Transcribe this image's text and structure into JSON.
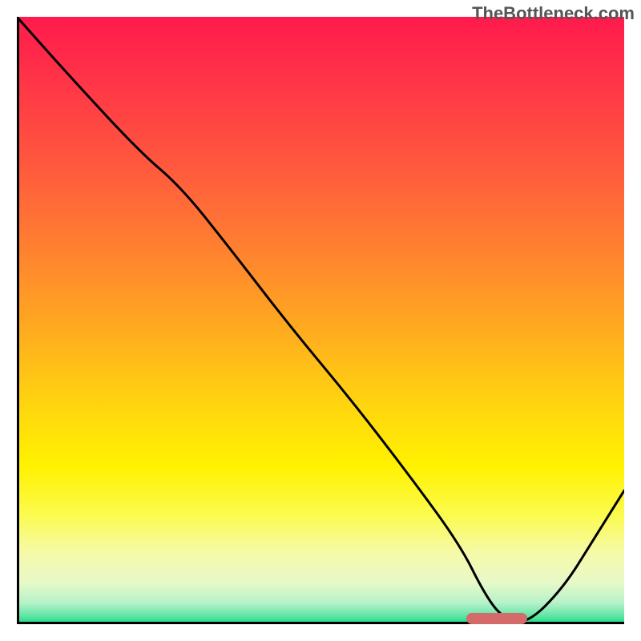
{
  "watermark": "TheBottleneck.com",
  "colors": {
    "frame": "#000000",
    "curve": "#000000",
    "marker": "#d46a6a",
    "gradient_stops": [
      {
        "offset": 0.0,
        "color": "#ff1a4d"
      },
      {
        "offset": 0.12,
        "color": "#ff3846"
      },
      {
        "offset": 0.25,
        "color": "#ff5a3d"
      },
      {
        "offset": 0.38,
        "color": "#ff8030"
      },
      {
        "offset": 0.5,
        "color": "#ffa621"
      },
      {
        "offset": 0.62,
        "color": "#ffcf12"
      },
      {
        "offset": 0.74,
        "color": "#fff200"
      },
      {
        "offset": 0.82,
        "color": "#fbfb4e"
      },
      {
        "offset": 0.88,
        "color": "#f6faa6"
      },
      {
        "offset": 0.93,
        "color": "#e8f9c8"
      },
      {
        "offset": 0.965,
        "color": "#b6f2c9"
      },
      {
        "offset": 0.985,
        "color": "#66e6a8"
      },
      {
        "offset": 1.0,
        "color": "#12db82"
      }
    ]
  },
  "chart_data": {
    "type": "line",
    "title": "",
    "xlabel": "",
    "ylabel": "",
    "xlim": [
      0,
      100
    ],
    "ylim": [
      0,
      100
    ],
    "grid": false,
    "series": [
      {
        "name": "curve",
        "x": [
          0,
          8,
          20,
          27,
          35,
          45,
          55,
          65,
          73,
          77,
          80,
          84,
          90,
          95,
          100
        ],
        "values": [
          100,
          91,
          78,
          72,
          62,
          49,
          37,
          24,
          13,
          5,
          1,
          0,
          6,
          14,
          22
        ]
      }
    ],
    "marker_range_x": [
      74,
      84
    ]
  }
}
